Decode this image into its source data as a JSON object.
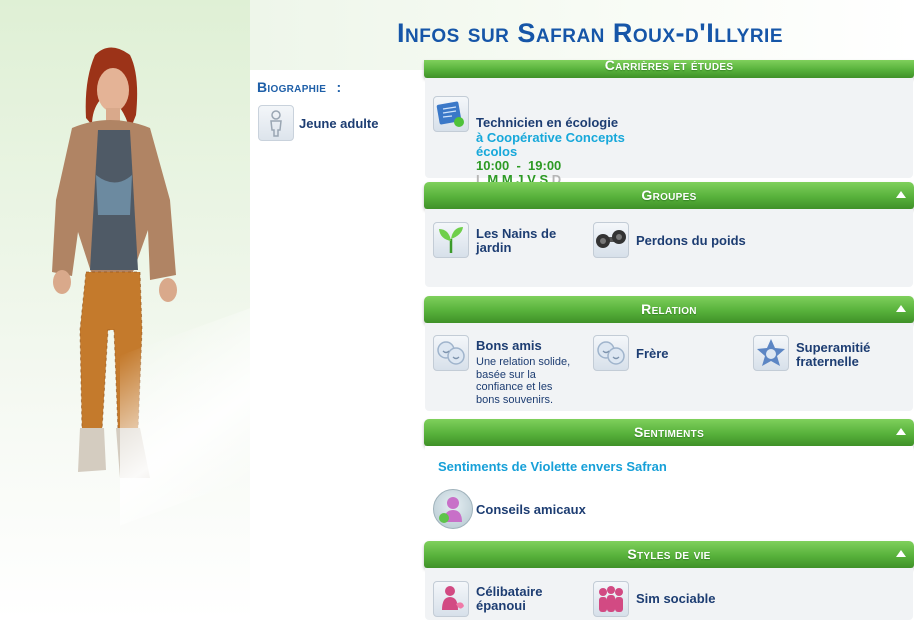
{
  "header": {
    "title": "Infos sur Safran Roux-d'Illyrie"
  },
  "biography": {
    "label": "Biographie",
    "colon": ":",
    "age_trait": "Jeune adulte"
  },
  "career": {
    "section_title": "Carrières et études",
    "job_title": "Technicien en écologie",
    "workplace_line1": "à Coopérative Concepts",
    "workplace_line2": "écolos",
    "hours": "10:00  -  19:00",
    "days": [
      {
        "label": "L",
        "active": false
      },
      {
        "label": "M",
        "active": true
      },
      {
        "label": "M",
        "active": true
      },
      {
        "label": "J",
        "active": true
      },
      {
        "label": "V",
        "active": true
      },
      {
        "label": "S",
        "active": true
      },
      {
        "label": "D",
        "active": false
      }
    ]
  },
  "groups": {
    "section_title": "Groupes",
    "items": [
      {
        "name_line1": "Les Nains de",
        "name_line2": "jardin",
        "icon": "sprout-icon"
      },
      {
        "name": "Perdons du poids",
        "icon": "dumbbell-icon"
      }
    ]
  },
  "relation": {
    "section_title": "Relation",
    "items": [
      {
        "name": "Bons amis",
        "description_lines": [
          "Une relation solide,",
          "basée sur la",
          "confiance et les",
          "bons souvenirs."
        ],
        "icon": "friends-faces-icon"
      },
      {
        "name": "Frère",
        "icon": "sibling-faces-icon"
      },
      {
        "name_line1": "Superamitié",
        "name_line2": "fraternelle",
        "icon": "star-face-icon"
      }
    ]
  },
  "sentiments": {
    "section_title": "Sentiments",
    "subtitle": "Sentiments de Violette envers Safran",
    "items": [
      {
        "name": "Conseils amicaux",
        "icon": "advice-sim-icon"
      }
    ]
  },
  "lifestyles": {
    "section_title": "Styles de vie",
    "items": [
      {
        "name_line1": "Célibataire",
        "name_line2": "épanoui",
        "icon": "single-sim-icon"
      },
      {
        "name": "Sim sociable",
        "icon": "social-group-icon"
      }
    ]
  }
}
